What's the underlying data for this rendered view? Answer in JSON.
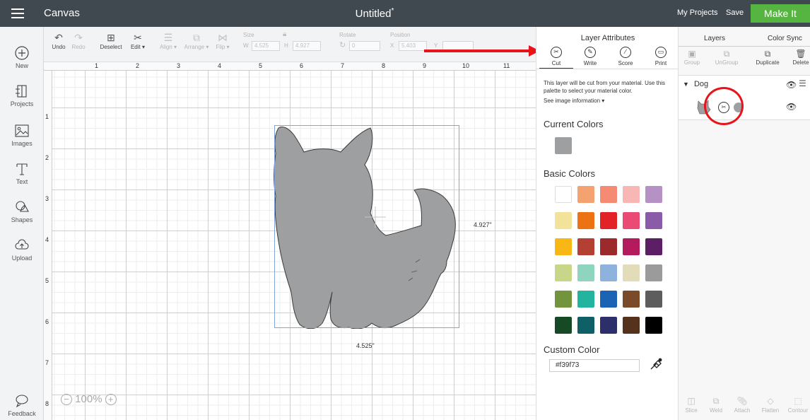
{
  "topbar": {
    "app_title": "Canvas",
    "document_title": "Untitled",
    "unsaved_marker": "*",
    "my_projects": "My Projects",
    "save": "Save",
    "make_it": "Make It"
  },
  "left_tools": [
    {
      "label": "New",
      "icon": "plus-circle-icon"
    },
    {
      "label": "Projects",
      "icon": "projects-icon"
    },
    {
      "label": "Images",
      "icon": "images-icon"
    },
    {
      "label": "Text",
      "icon": "text-icon"
    },
    {
      "label": "Shapes",
      "icon": "shapes-icon"
    },
    {
      "label": "Upload",
      "icon": "upload-icon"
    },
    {
      "label": "Feedback",
      "icon": "feedback-icon"
    }
  ],
  "edit_toolbar": {
    "undo": "Undo",
    "redo": "Redo",
    "deselect": "Deselect",
    "edit": "Edit",
    "align": "Align",
    "arrange": "Arrange",
    "flip": "Flip",
    "size_label": "Size",
    "w_label": "W",
    "w_value": "4.525",
    "h_label": "H",
    "h_value": "4.927",
    "rotate_label": "Rotate",
    "rotate_value": "0",
    "position_label": "Position",
    "x_label": "X",
    "x_value": "5.403",
    "y_label": "Y"
  },
  "ruler": {
    "h_numbers": [
      "1",
      "2",
      "3",
      "4",
      "5",
      "6",
      "7",
      "8",
      "9",
      "10",
      "11"
    ],
    "v_numbers": [
      "1",
      "2",
      "3",
      "4",
      "5",
      "6",
      "7",
      "8"
    ]
  },
  "canvas": {
    "width_label": "4.525\"",
    "height_label": "4.927\"",
    "zoom": "100%",
    "shape_color": "#9d9fa0"
  },
  "layer_attributes": {
    "title": "Layer Attributes",
    "tabs": [
      "Cut",
      "Write",
      "Score",
      "Print"
    ],
    "active_tab": "Cut",
    "description": "This layer will be cut from your material. Use this palette to select your material color.",
    "see_info": "See image information",
    "current_colors_title": "Current Colors",
    "current_color": "#9d9fa0",
    "basic_colors_title": "Basic Colors",
    "basic_colors": [
      [
        "#ffffff",
        "#f4a26f",
        "#f48b72",
        "#f8b7b4",
        "#b591c6"
      ],
      [
        "#f3e39a",
        "#ed7214",
        "#e32228",
        "#e94b74",
        "#8a5ba8"
      ],
      [
        "#f8b714",
        "#b44033",
        "#9b2a2c",
        "#b41b5e",
        "#5c1f66"
      ],
      [
        "#c8d68a",
        "#8ed4bf",
        "#8db2dd",
        "#e3dcb8",
        "#9b9b9b"
      ],
      [
        "#72943c",
        "#22b49e",
        "#1b63b5",
        "#7a4b2a",
        "#5d5d5d"
      ],
      [
        "#164a26",
        "#0f6066",
        "#2c2f6a",
        "#54321c",
        "#000000"
      ]
    ],
    "custom_color_title": "Custom Color",
    "custom_color_value": "#f39f73"
  },
  "layers_panel": {
    "tabs": [
      "Layers",
      "Color Sync"
    ],
    "actions": [
      "Group",
      "UnGroup",
      "Duplicate",
      "Delete"
    ],
    "group_name": "Dog",
    "layer_color": "#9d9fa0",
    "bottom_actions": [
      "Slice",
      "Weld",
      "Attach",
      "Flatten",
      "Contour"
    ]
  }
}
